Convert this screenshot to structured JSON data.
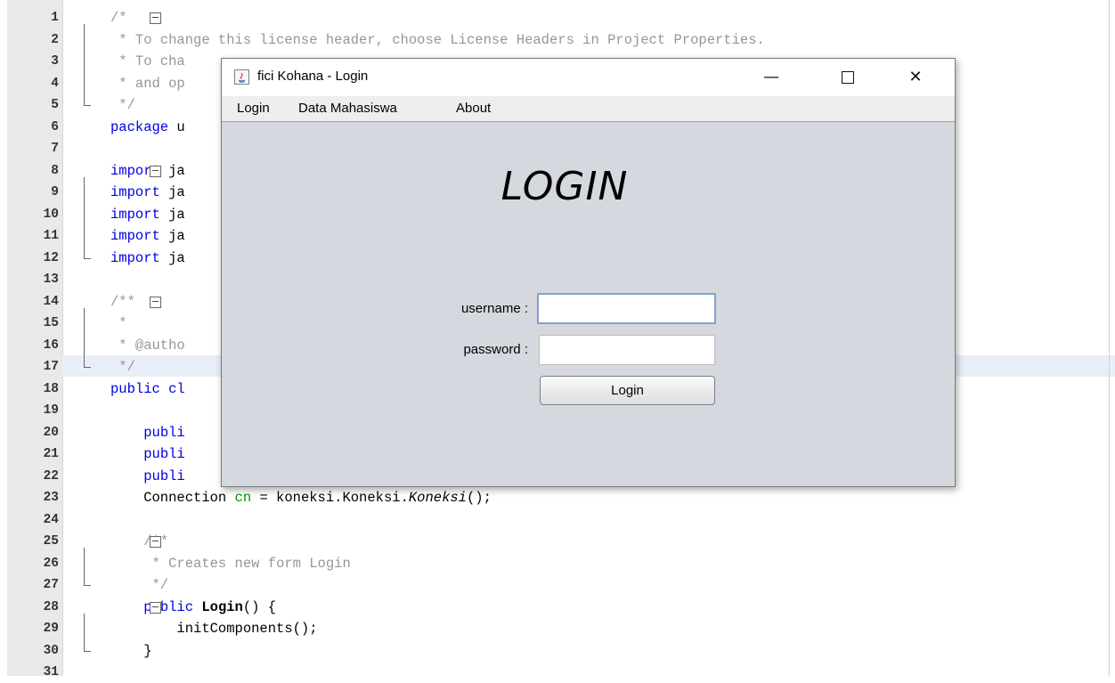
{
  "editor": {
    "lines": [
      {
        "n": "1",
        "fold": "open",
        "segs": [
          {
            "t": "/*",
            "c": "cm"
          }
        ]
      },
      {
        "n": "2",
        "segs": [
          {
            "t": " * To change this license header, choose License Headers in Project Properties.",
            "c": "cm"
          }
        ]
      },
      {
        "n": "3",
        "segs": [
          {
            "t": " * To cha",
            "c": "cm"
          }
        ]
      },
      {
        "n": "4",
        "segs": [
          {
            "t": " * and op",
            "c": "cm"
          }
        ]
      },
      {
        "n": "5",
        "fold": "end",
        "segs": [
          {
            "t": " */",
            "c": "cm"
          }
        ]
      },
      {
        "n": "6",
        "segs": [
          {
            "t": "package",
            "c": "kw"
          },
          {
            "t": " u",
            "c": ""
          }
        ]
      },
      {
        "n": "7",
        "segs": []
      },
      {
        "n": "8",
        "fold": "open",
        "segs": [
          {
            "t": "import",
            "c": "kw"
          },
          {
            "t": " ja",
            "c": ""
          }
        ]
      },
      {
        "n": "9",
        "segs": [
          {
            "t": "import",
            "c": "kw"
          },
          {
            "t": " ja",
            "c": ""
          }
        ]
      },
      {
        "n": "10",
        "segs": [
          {
            "t": "import",
            "c": "kw"
          },
          {
            "t": " ja",
            "c": ""
          }
        ]
      },
      {
        "n": "11",
        "segs": [
          {
            "t": "import",
            "c": "kw"
          },
          {
            "t": " ja",
            "c": ""
          }
        ]
      },
      {
        "n": "12",
        "fold": "end",
        "segs": [
          {
            "t": "import",
            "c": "kw"
          },
          {
            "t": " ja",
            "c": ""
          }
        ]
      },
      {
        "n": "13",
        "segs": []
      },
      {
        "n": "14",
        "fold": "open",
        "segs": [
          {
            "t": "/**",
            "c": "cm"
          }
        ]
      },
      {
        "n": "15",
        "segs": [
          {
            "t": " *",
            "c": "cm"
          }
        ]
      },
      {
        "n": "16",
        "segs": [
          {
            "t": " * @autho",
            "c": "cm"
          }
        ]
      },
      {
        "n": "17",
        "fold": "end",
        "segs": [
          {
            "t": " */",
            "c": "cm"
          }
        ]
      },
      {
        "n": "18",
        "segs": [
          {
            "t": "public",
            "c": "kw"
          },
          {
            "t": " cl",
            "c": "kw"
          }
        ]
      },
      {
        "n": "19",
        "segs": []
      },
      {
        "n": "20",
        "segs": [
          {
            "t": "    ",
            "c": ""
          },
          {
            "t": "publi",
            "c": "kw"
          }
        ]
      },
      {
        "n": "21",
        "segs": [
          {
            "t": "    ",
            "c": ""
          },
          {
            "t": "publi",
            "c": "kw"
          }
        ]
      },
      {
        "n": "22",
        "segs": [
          {
            "t": "    ",
            "c": ""
          },
          {
            "t": "publi",
            "c": "kw"
          }
        ]
      },
      {
        "n": "23",
        "segs": [
          {
            "t": "    Connection ",
            "c": ""
          },
          {
            "t": "cn",
            "c": "fld"
          },
          {
            "t": " = koneksi.Koneksi.",
            "c": ""
          },
          {
            "t": "Koneksi",
            "c": "it"
          },
          {
            "t": "();",
            "c": ""
          }
        ]
      },
      {
        "n": "24",
        "segs": []
      },
      {
        "n": "25",
        "fold": "open",
        "segs": [
          {
            "t": "    ",
            "c": ""
          },
          {
            "t": "/**",
            "c": "cm"
          }
        ]
      },
      {
        "n": "26",
        "segs": [
          {
            "t": "     * Creates new form Login",
            "c": "cm"
          }
        ]
      },
      {
        "n": "27",
        "fold": "end",
        "segs": [
          {
            "t": "     */",
            "c": "cm"
          }
        ]
      },
      {
        "n": "28",
        "fold": "open",
        "segs": [
          {
            "t": "    ",
            "c": ""
          },
          {
            "t": "public",
            "c": "kw"
          },
          {
            "t": " ",
            "c": ""
          },
          {
            "t": "Login",
            "c": "bold"
          },
          {
            "t": "() {",
            "c": ""
          }
        ]
      },
      {
        "n": "29",
        "segs": [
          {
            "t": "        initComponents();",
            "c": ""
          }
        ]
      },
      {
        "n": "30",
        "fold": "end",
        "segs": [
          {
            "t": "    }",
            "c": ""
          }
        ]
      },
      {
        "n": "31",
        "segs": []
      }
    ]
  },
  "dialog": {
    "title": "fici Kohana - Login",
    "minimize_icon": "minimize-icon",
    "maximize_icon": "maximize-icon",
    "close_icon": "close-icon",
    "menu": [
      "Login",
      "Data Mahasiswa",
      "About"
    ],
    "heading": "LOGIN",
    "username_label": "username :",
    "password_label": "password :",
    "username_value": "",
    "password_value": "",
    "login_button": "Login"
  },
  "colors": {
    "keyword": "#0000e6",
    "comment": "#969696",
    "field": "#009900",
    "dialog_bg": "#d5d8de"
  }
}
